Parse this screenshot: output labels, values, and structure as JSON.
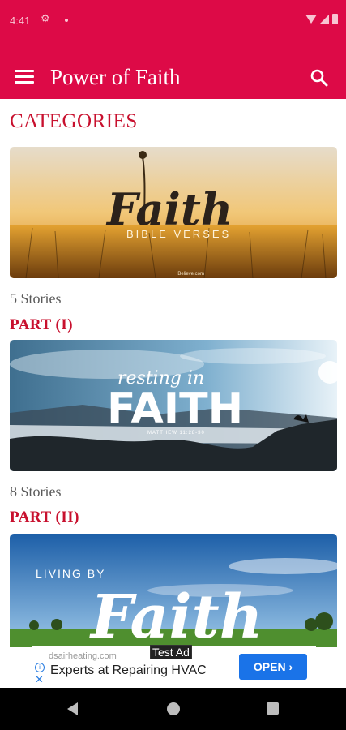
{
  "status_bar": {
    "time": "4:41",
    "gear_icon": "gear-icon",
    "wifi_icon": "wifi-icon",
    "signal_icon": "signal-icon",
    "battery_icon": "battery-icon"
  },
  "app_bar": {
    "title": "Power of Faith",
    "menu_icon": "hamburger-menu-icon",
    "search_icon": "search-icon",
    "color": "#dd0a47"
  },
  "section": {
    "title": "CATEGORIES"
  },
  "categories": [
    {
      "image_text": "Faith",
      "image_subtitle": "BIBLE VERSES",
      "image_watermark": "iBelieve.com",
      "stories": "5 Stories",
      "part": "PART (I)"
    },
    {
      "image_script": "resting in",
      "image_text": "FAITH",
      "image_subtitle": "MATTHEW 11:28-30",
      "stories": "8 Stories",
      "part": "PART (II)"
    },
    {
      "image_caption": "LIVING BY",
      "image_text": "Faith"
    }
  ],
  "ad": {
    "label": "Test Ad",
    "domain": "dsairheating.com",
    "headline": "Experts at Repairing HVAC",
    "button": "OPEN ›",
    "info_icon": "info-icon",
    "close_icon": "close-icon",
    "button_color": "#1a73e8"
  },
  "nav_bar": {
    "back_icon": "back-icon",
    "home_icon": "home-icon",
    "recents_icon": "recents-icon"
  }
}
